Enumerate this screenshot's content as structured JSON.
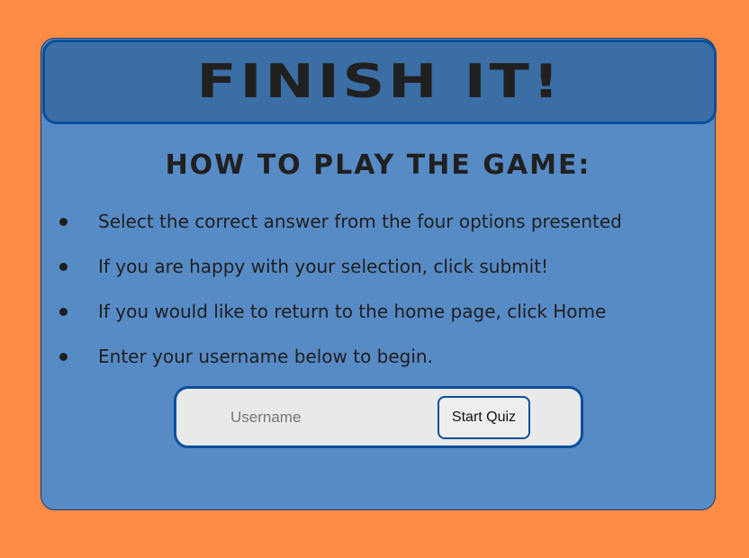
{
  "header": {
    "title": "FINISH IT!"
  },
  "instructions": {
    "heading": "HOW TO PLAY THE GAME:",
    "items": [
      "Select the correct answer from the four options presented",
      "If you are happy with your selection, click submit!",
      "If you would like to return to the home page, click Home",
      "Enter your username below to begin."
    ]
  },
  "form": {
    "username_placeholder": "Username",
    "username_value": "",
    "start_label": "Start Quiz"
  },
  "colors": {
    "page_background": "#ff8c45",
    "card_background": "#578bc5",
    "header_background": "#3b6ea5",
    "border_accent": "#0a4f9a"
  }
}
